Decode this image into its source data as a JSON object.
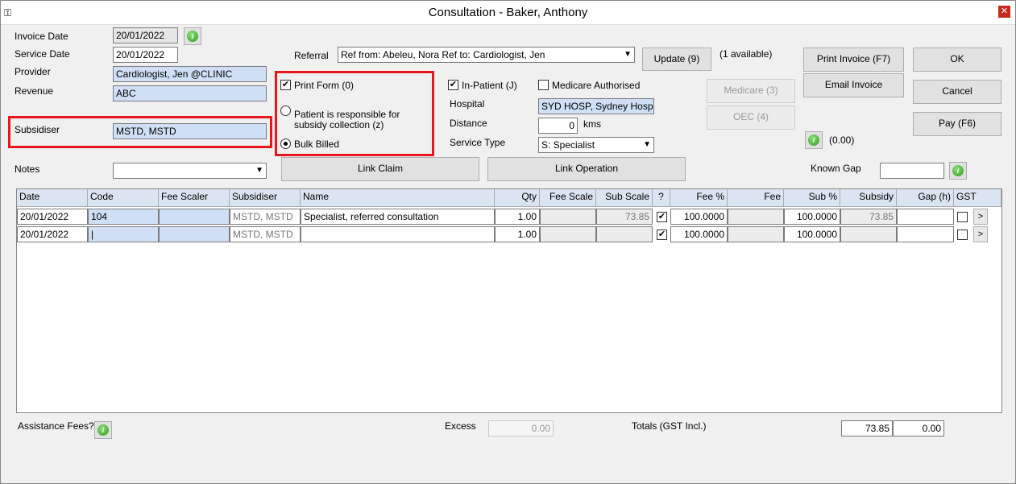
{
  "window": {
    "title": "Consultation - Baker, Anthony",
    "close_label": "✕",
    "icon": "key-icon"
  },
  "left": {
    "invoice_date_label": "Invoice Date",
    "invoice_date_value": "20/01/2022",
    "service_date_label": "Service Date",
    "service_date_value": "20/01/2022",
    "provider_label": "Provider",
    "provider_value": "Cardiologist, Jen @CLINIC",
    "revenue_label": "Revenue",
    "revenue_value": "ABC",
    "subsidiser_label": "Subsidiser",
    "subsidiser_value": "MSTD, MSTD",
    "notes_label": "Notes",
    "notes_value": ""
  },
  "referral": {
    "label": "Referral",
    "value": "Ref from: Abeleu, Nora Ref to: Cardiologist, Jen",
    "update_button": "Update (9)",
    "available": "(1 available)"
  },
  "options": {
    "print_form": "Print Form (0)",
    "patient_responsible": "Patient is responsible for subsidy collection (z)",
    "bulk_billed": "Bulk Billed"
  },
  "hospital": {
    "in_patient": "In-Patient (J)",
    "medicare_authorised": "Medicare Authorised",
    "hospital_label": "Hospital",
    "hospital_value": "SYD HOSP, Sydney Hospital",
    "distance_label": "Distance",
    "distance_value": "0",
    "distance_unit": "kms",
    "service_type_label": "Service Type",
    "service_type_value": "S: Specialist"
  },
  "buttons": {
    "medicare": "Medicare (3)",
    "oec": "OEC (4)",
    "print_invoice": "Print Invoice (F7)",
    "email_invoice": "Email Invoice",
    "ok": "OK",
    "cancel": "Cancel",
    "pay": "Pay (F6)",
    "info_amount": "(0.00)",
    "link_claim": "Link Claim",
    "link_operation": "Link Operation"
  },
  "known_gap": {
    "label": "Known Gap",
    "value": ""
  },
  "grid": {
    "headers": [
      "Date",
      "Code",
      "Fee Scaler",
      "Subsidiser",
      "Name",
      "Qty",
      "Fee Scale",
      "Sub Scale",
      "?",
      "Fee %",
      "Fee",
      "Sub %",
      "Subsidy",
      "Gap (h)",
      "GST"
    ],
    "rows": [
      {
        "date": "20/01/2022",
        "code": "104",
        "fee_scaler": "",
        "subsidiser": "MSTD, MSTD",
        "name": "Specialist, referred consultation",
        "qty": "1.00",
        "fee_scale": "",
        "sub_scale": "73.85",
        "q": true,
        "fee_pct": "100.0000",
        "fee": "",
        "sub_pct": "100.0000",
        "subsidy": "73.85",
        "gap": "",
        "gst": false,
        "more": ">"
      },
      {
        "date": "20/01/2022",
        "code": "|",
        "fee_scaler": "",
        "subsidiser": "MSTD, MSTD",
        "name": "",
        "qty": "1.00",
        "fee_scale": "",
        "sub_scale": "",
        "q": true,
        "fee_pct": "100.0000",
        "fee": "",
        "sub_pct": "100.0000",
        "subsidy": "",
        "gap": "",
        "gst": false,
        "more": ">"
      }
    ]
  },
  "footer": {
    "assistance_label": "Assistance Fees?",
    "excess_label": "Excess",
    "excess_value": "0.00",
    "totals_label": "Totals (GST Incl.)",
    "total_value": "73.85",
    "total_gap": "0.00"
  },
  "colors": {
    "highlight": "#e8161b",
    "header_bg": "#dbe5f1",
    "field_blue": "#cfdff5"
  }
}
